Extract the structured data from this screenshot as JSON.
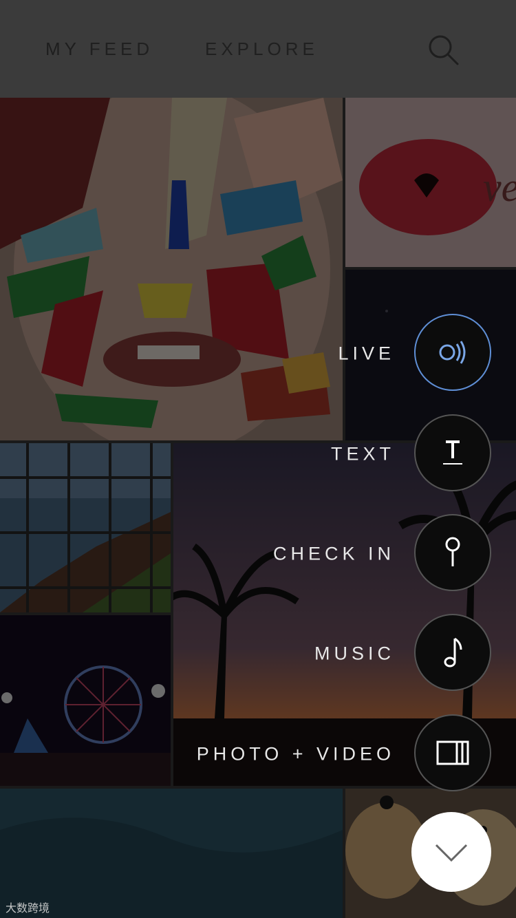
{
  "header": {
    "tabs": [
      {
        "label_prefix": "MY",
        "label_rest": "FEED"
      },
      {
        "label": "EXPLORE"
      }
    ],
    "search_icon": "search-icon"
  },
  "actions": [
    {
      "label": "LIVE",
      "icon": "live-broadcast-icon"
    },
    {
      "label": "TEXT",
      "icon": "text-icon"
    },
    {
      "label": "CHECK IN",
      "icon": "location-pin-icon"
    },
    {
      "label": "MUSIC",
      "icon": "music-note-icon"
    },
    {
      "label": "PHOTO + VIDEO",
      "icon": "film-icon"
    }
  ],
  "collapse_icon": "chevron-down-icon",
  "watermark": "大数跨境",
  "colors": {
    "live_ring": "#5f8fd6",
    "overlay": "rgba(0,0,0,0.55)",
    "action_bg": "#0c0c0c"
  }
}
